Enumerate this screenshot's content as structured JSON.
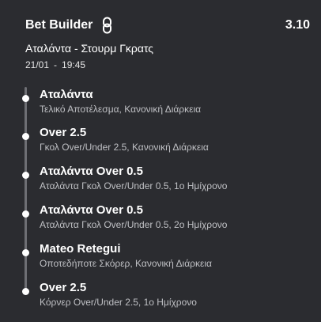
{
  "header": {
    "title": "Bet Builder",
    "odds": "3.10",
    "icon": "link-icon"
  },
  "event": {
    "match": "Αταλάντα - Στουρμ Γκρατς",
    "date": "21/01",
    "separator": "-",
    "time": "19:45"
  },
  "selections": [
    {
      "name": "Αταλάντα",
      "market": "Τελικό Αποτέλεσμα, Κανονική Διάρκεια"
    },
    {
      "name": "Over 2.5",
      "market": "Γκολ Over/Under 2.5, Κανονική Διάρκεια"
    },
    {
      "name": "Αταλάντα Over 0.5",
      "market": "Αταλάντα Γκολ Over/Under 0.5, 1ο Ημίχρονο"
    },
    {
      "name": "Αταλάντα Over 0.5",
      "market": "Αταλάντα Γκολ Over/Under 0.5, 2ο Ημίχρονο"
    },
    {
      "name": "Mateo Retegui",
      "market": "Οποτεδήποτε Σκόρερ, Κανονική Διάρκεια"
    },
    {
      "name": "Over 2.5",
      "market": "Κόρνερ Over/Under 2.5, 1ο Ημίχρονο"
    }
  ],
  "colors": {
    "background": "#2b2c30",
    "timeline": "#6e6f74",
    "secondary_text": "#bfc0c4"
  }
}
